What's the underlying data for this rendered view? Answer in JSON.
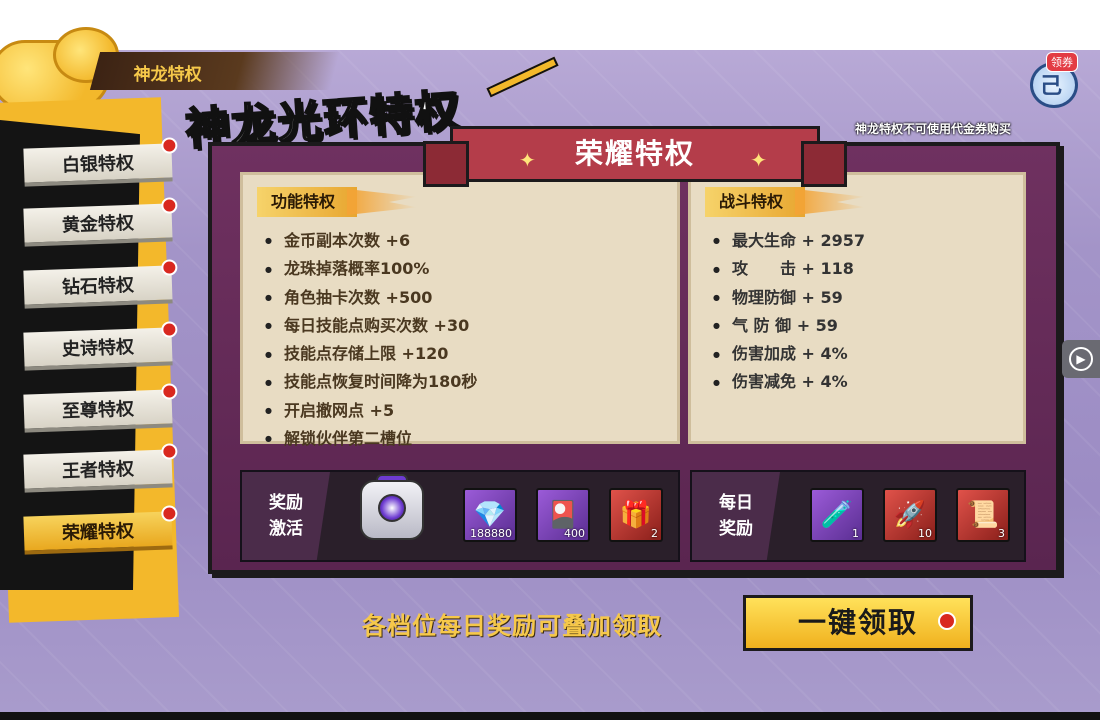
{
  "header": {
    "top_tab": "神龙特权",
    "big_title": "神龙光环特权",
    "coupon_badge": "领券",
    "note": "神龙特权不可使用代金券购买"
  },
  "sidebar": {
    "items": [
      {
        "label": "白银特权",
        "red_dot": true,
        "active": false
      },
      {
        "label": "黄金特权",
        "red_dot": true,
        "active": false
      },
      {
        "label": "钻石特权",
        "red_dot": true,
        "active": false
      },
      {
        "label": "史诗特权",
        "red_dot": true,
        "active": false
      },
      {
        "label": "至尊特权",
        "red_dot": true,
        "active": false
      },
      {
        "label": "王者特权",
        "red_dot": true,
        "active": false
      },
      {
        "label": "荣耀特权",
        "red_dot": true,
        "active": true
      }
    ]
  },
  "panel": {
    "ribbon_title": "荣耀特权",
    "function_header": "功能特权",
    "function_list": [
      "金币副本次数 +6",
      "龙珠掉落概率100%",
      "角色抽卡次数 +500",
      "每日技能点购买次数 +30",
      "技能点存储上限 +120",
      "技能点恢复时间降为180秒",
      "开启撤网点 +5",
      "解锁伙伴第二槽位"
    ],
    "battle_header": "战斗特权",
    "battle_list": [
      "最大生命 + 2957",
      "攻　　击 + 118",
      "物理防御 + 59",
      "气 防 御 + 59",
      "伤害加成 + 4%",
      "伤害减免 + 4%"
    ],
    "activation": {
      "label_line1": "奖励",
      "label_line2": "激活",
      "items": [
        {
          "icon": "diamond-icon",
          "glyph": "💎",
          "count": "188880",
          "rarity": "purple"
        },
        {
          "icon": "card-pack-icon",
          "glyph": "🎴",
          "count": "400",
          "rarity": "purple"
        },
        {
          "icon": "gift-box-icon",
          "glyph": "🎁",
          "count": "2",
          "rarity": "red"
        }
      ]
    },
    "daily": {
      "label_line1": "每日",
      "label_line2": "奖励",
      "items": [
        {
          "icon": "potion-bottle-icon",
          "glyph": "🧪",
          "count": "1",
          "rarity": "purple"
        },
        {
          "icon": "rocket-icon",
          "glyph": "🚀",
          "count": "10",
          "rarity": "red"
        },
        {
          "icon": "scroll-icon",
          "glyph": "📜",
          "count": "3",
          "rarity": "red"
        }
      ]
    }
  },
  "footer": {
    "text": "各档位每日奖励可叠加领取",
    "claim_button": "一键领取"
  },
  "colors": {
    "accent_gold": "#f3b82b",
    "panel_purple": "#6f3160",
    "ribbon_red": "#b43d4a",
    "red_dot": "#d9281f"
  }
}
